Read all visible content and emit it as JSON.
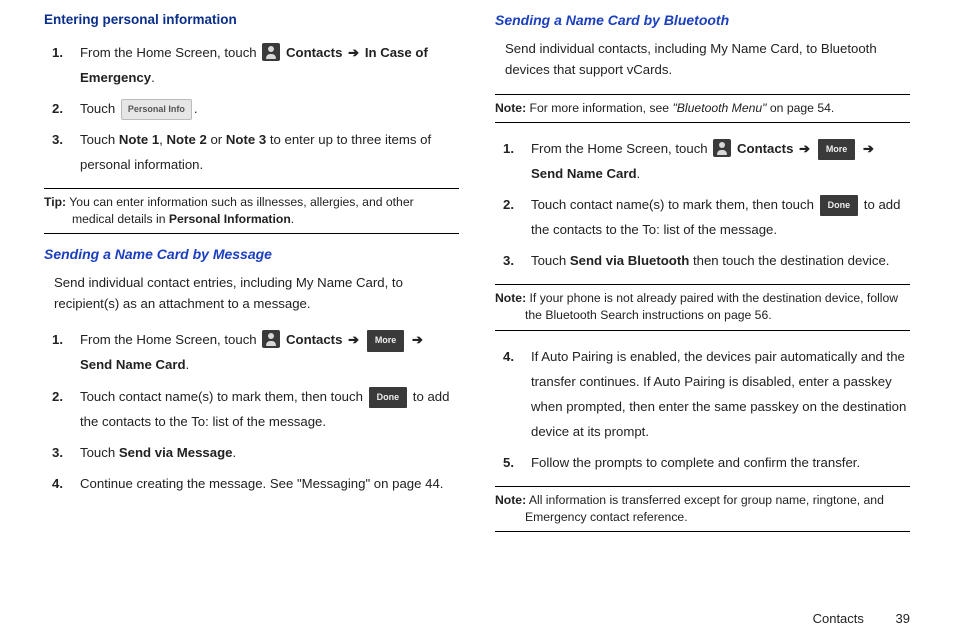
{
  "left": {
    "heading1": "Entering personal information",
    "s1_1_a": "From the Home Screen, touch ",
    "s1_1_b": "Contacts",
    "s1_1_arrow": "➔",
    "s1_1_c": "In Case of Emergency",
    "s1_2_a": "Touch ",
    "s1_2_btn": "Personal Info",
    "s1_3_a": "Touch ",
    "s1_3_b": "Note 1",
    "s1_3_c": ", ",
    "s1_3_d": "Note 2",
    "s1_3_e": " or ",
    "s1_3_f": "Note 3",
    "s1_3_g": " to enter up to three items of personal information.",
    "tip_label": "Tip:",
    "tip_a": " You can enter information such as illnesses, allergies, and other medical details in ",
    "tip_b": "Personal Information",
    "heading2": "Sending a Name Card by Message",
    "p1": "Send individual contact entries, including My Name Card, to recipient(s) as an attachment to a message.",
    "s2_1_a": "From the Home Screen, touch ",
    "s2_1_b": "Contacts",
    "s2_1_arrow": "➔",
    "s2_1_btn": "More",
    "s2_1_arrow2": "➔",
    "s2_1_c": "Send Name Card",
    "s2_2_a": "Touch contact name(s) to mark them, then touch ",
    "s2_2_btn": "Done",
    "s2_2_b": " to add the contacts to the To: list of the message.",
    "s2_3_a": "Touch ",
    "s2_3_b": "Send via Message",
    "s2_4": "Continue creating the message. See \"Messaging\" on page 44."
  },
  "right": {
    "heading3": "Sending a Name Card by Bluetooth",
    "p2": "Send individual contacts, including My Name Card, to Bluetooth devices that support vCards.",
    "note1_label": "Note:",
    "note1_a": " For more information, see ",
    "note1_b": "\"Bluetooth Menu\"",
    "note1_c": " on page 54.",
    "s3_1_a": "From the Home Screen, touch ",
    "s3_1_b": "Contacts",
    "s3_1_arrow": "➔",
    "s3_1_btn": "More",
    "s3_1_arrow2": "➔",
    "s3_1_c": "Send Name Card",
    "s3_2_a": "Touch contact name(s) to mark them, then touch ",
    "s3_2_btn": "Done",
    "s3_2_b": " to add the contacts to the To: list of the message.",
    "s3_3_a": "Touch ",
    "s3_3_b": "Send via Bluetooth",
    "s3_3_c": " then touch the destination device.",
    "note2_label": "Note:",
    "note2_a": " If your phone is not already paired with the destination device, follow the Bluetooth Search instructions on page 56.",
    "s3_4": "If Auto Pairing is enabled, the devices pair automatically and the transfer continues. If Auto Pairing is disabled, enter a passkey when prompted, then enter the same passkey on the destination device at its prompt.",
    "s3_5": "Follow the prompts to complete and confirm the transfer.",
    "note3_label": "Note:",
    "note3_a": "  All information is transferred except for group name, ringtone, and Emergency contact reference."
  },
  "footer": {
    "chapter": "Contacts",
    "page": "39"
  },
  "nums": {
    "n1": "1.",
    "n2": "2.",
    "n3": "3.",
    "n4": "4.",
    "n5": "5."
  }
}
